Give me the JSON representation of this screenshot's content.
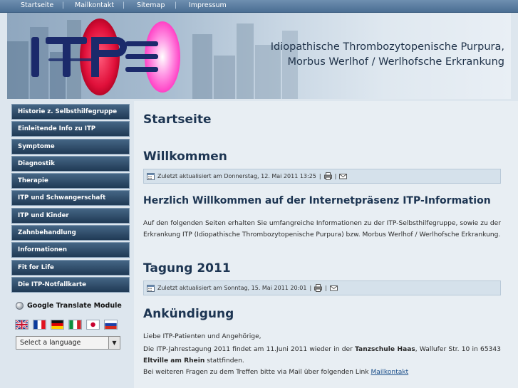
{
  "topnav": {
    "items": [
      "Startseite",
      "Mailkontakt",
      "Sitemap",
      "Impressum"
    ],
    "separator": "|"
  },
  "banner": {
    "logo_text": "ITP",
    "tagline_line1": "Idiopathische Thrombozytopenische Purpura,",
    "tagline_line2": "Morbus Werlhof / Werlhofsche Erkrankung"
  },
  "sidebar": {
    "menu": [
      "Historie z. Selbsthilfegruppe",
      "Einleitende Info zu ITP",
      "Symptome",
      "Diagnostik",
      "Therapie",
      "ITP und Schwangerschaft",
      "ITP und Kinder",
      "Zahnbehandlung",
      "Informationen",
      "Fit for Life",
      "Die ITP-Notfallkarte"
    ],
    "translate_title": "Google Translate Module",
    "flags": [
      "uk-flag",
      "france-flag",
      "germany-flag",
      "italy-flag",
      "japan-flag",
      "russia-flag"
    ],
    "language_select": "Select a language"
  },
  "main": {
    "page_title": "Startseite",
    "article1": {
      "title": "Willkommen",
      "meta": "Zuletzt aktualisiert am Donnerstag, 12. Mai 2011 13:25",
      "subtitle": "Herzlich Willkommen auf der Internetpräsenz ITP-Information",
      "body": "Auf den folgenden Seiten erhalten Sie umfangreiche Informationen zu der ITP-Selbsthilfegruppe, sowie zu der Erkrankung ITP (Idiopathische Thrombozytopenische Purpura) bzw. Morbus Werlhof / Werlhofsche Erkrankung."
    },
    "article2": {
      "title": "Tagung 2011",
      "meta": "Zuletzt aktualisiert am Sonntag, 15. Mai 2011 20:01",
      "subtitle": "Ankündigung",
      "greeting": "Liebe ITP-Patienten und Angehörige,",
      "body_pre": "Die ITP-Jahrestagung 2011 findet am 11.Juni 2011 wieder in der",
      "body_bold1": "Tanzschule Haas",
      "body_mid": ", Wallufer Str. 10 in 65343",
      "body_bold2": "Eltville am Rhein",
      "body_post": "stattfinden.",
      "contact_pre": "Bei weiteren Fragen zu dem Treffen bitte via Mail über folgenden Link",
      "contact_link": "Mailkontakt"
    },
    "meta_separator": "|"
  },
  "colors": {
    "topnav": "#4b6e93",
    "menu_bg": "#2d4a67",
    "heading": "#1d3552",
    "meta_bg": "#d5e1eb",
    "logo_red": "#e0103a",
    "logo_pink": "#ff55cc",
    "logo_navy": "#1b2a6b"
  },
  "icons": [
    "calendar-icon",
    "print-icon",
    "email-icon"
  ]
}
